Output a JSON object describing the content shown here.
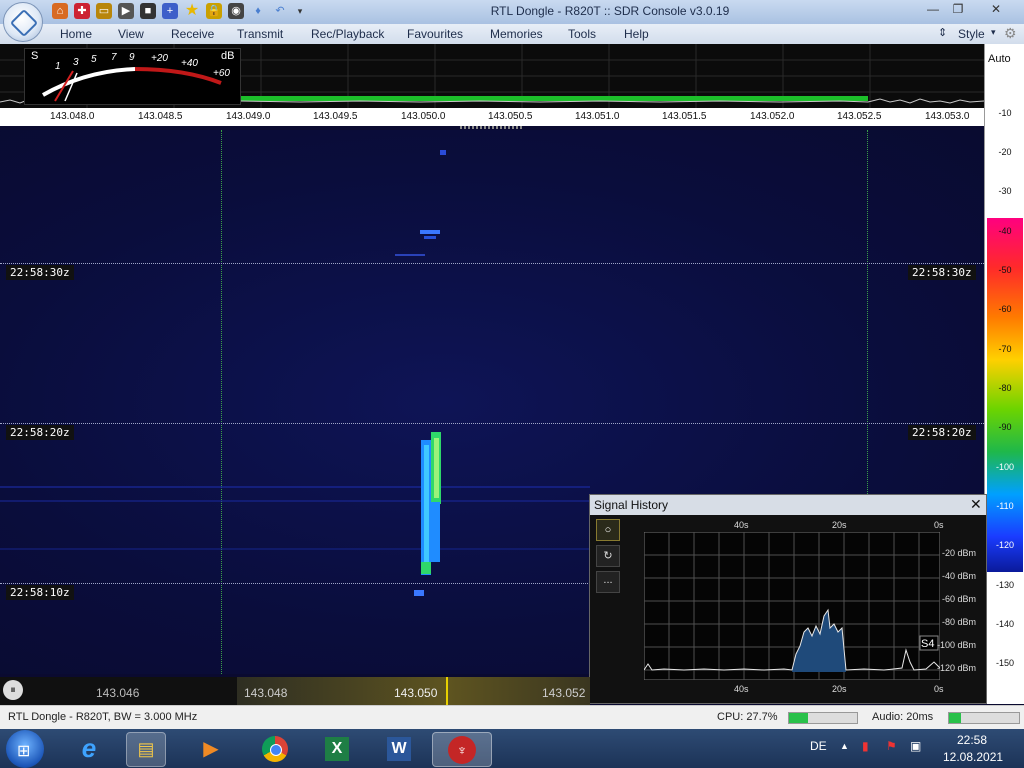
{
  "window": {
    "title": "RTL Dongle - R820T :: SDR Console v3.0.19"
  },
  "menu": {
    "items": [
      "Home",
      "View",
      "Receive",
      "Transmit",
      "Rec/Playback",
      "Favourites",
      "Memories",
      "Tools",
      "Help"
    ],
    "style_label": "Style"
  },
  "meter": {
    "s_label": "S",
    "db_label": "dB",
    "scale": [
      "1",
      "3",
      "5",
      "7",
      "9",
      "+20",
      "+40",
      "+60"
    ]
  },
  "spectrum": {
    "ticks": [
      "143.048.0",
      "143.048.5",
      "143.049.0",
      "143.049.5",
      "143.050.0",
      "143.050.5",
      "143.051.0",
      "143.051.5",
      "143.052.0",
      "143.052.5",
      "143.053.0"
    ]
  },
  "right_scale": {
    "auto_label": "Auto",
    "values": [
      "-10",
      "-20",
      "-30",
      "-40",
      "-50",
      "-60",
      "-70",
      "-80",
      "-90",
      "-100",
      "-110",
      "-120",
      "-130",
      "-140",
      "-150"
    ]
  },
  "waterfall": {
    "times": [
      "22:58:30z",
      "22:58:20z",
      "22:58:10z"
    ]
  },
  "signal_history": {
    "title": "Signal History",
    "top_ticks": [
      "40s",
      "20s",
      "0s"
    ],
    "bottom_ticks": [
      "40s",
      "20s",
      "0s"
    ],
    "dbm_labels": [
      "-20 dBm",
      "-40 dBm",
      "-60 dBm",
      "-80 dBm",
      "-100 dBm",
      "-120 dBm"
    ],
    "s_reading": "S4",
    "dots_label": "..."
  },
  "tuner": {
    "labels": [
      "143.046",
      "143.048",
      "143.050",
      "143.052"
    ]
  },
  "status": {
    "device": "RTL Dongle - R820T, BW = 3.000 MHz",
    "cpu": "CPU: 27.7%",
    "cpu_level": 0.277,
    "audio": "Audio: 20ms"
  },
  "taskbar": {
    "lang": "DE",
    "time": "22:58",
    "date": "12.08.2021"
  },
  "colors": {
    "accent": "#3c6ab0",
    "signal_green": "#2fd86a",
    "signal_blue": "#1f8cff"
  }
}
